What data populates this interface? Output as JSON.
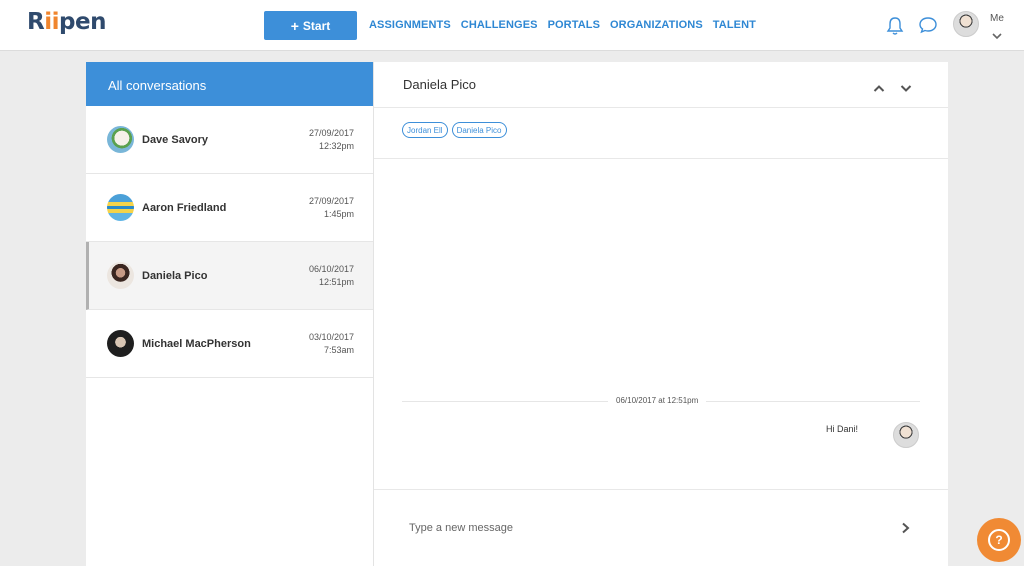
{
  "header": {
    "logo": "Riipen",
    "start_label": "Start",
    "nav": [
      "ASSIGNMENTS",
      "CHALLENGES",
      "PORTALS",
      "ORGANIZATIONS",
      "TALENT"
    ],
    "me_label": "Me"
  },
  "sidebar": {
    "title": "All conversations",
    "conversations": [
      {
        "name": "Dave Savory",
        "date": "27/09/2017",
        "time": "12:32pm"
      },
      {
        "name": "Aaron Friedland",
        "date": "27/09/2017",
        "time": "1:45pm"
      },
      {
        "name": "Daniela Pico",
        "date": "06/10/2017",
        "time": "12:51pm"
      },
      {
        "name": "Michael MacPherson",
        "date": "03/10/2017",
        "time": "7:53am"
      }
    ]
  },
  "thread": {
    "title": "Daniela Pico",
    "participants": [
      "Jordan Ell",
      "Daniela Pico"
    ],
    "timestamp": "06/10/2017 at 12:51pm",
    "message": "Hi Dani!",
    "compose_placeholder": "Type a new message"
  },
  "help": {
    "label": "?"
  },
  "colors": {
    "primary": "#3d8fd9",
    "accent": "#f08a34",
    "logo": "#2f4a6d"
  }
}
